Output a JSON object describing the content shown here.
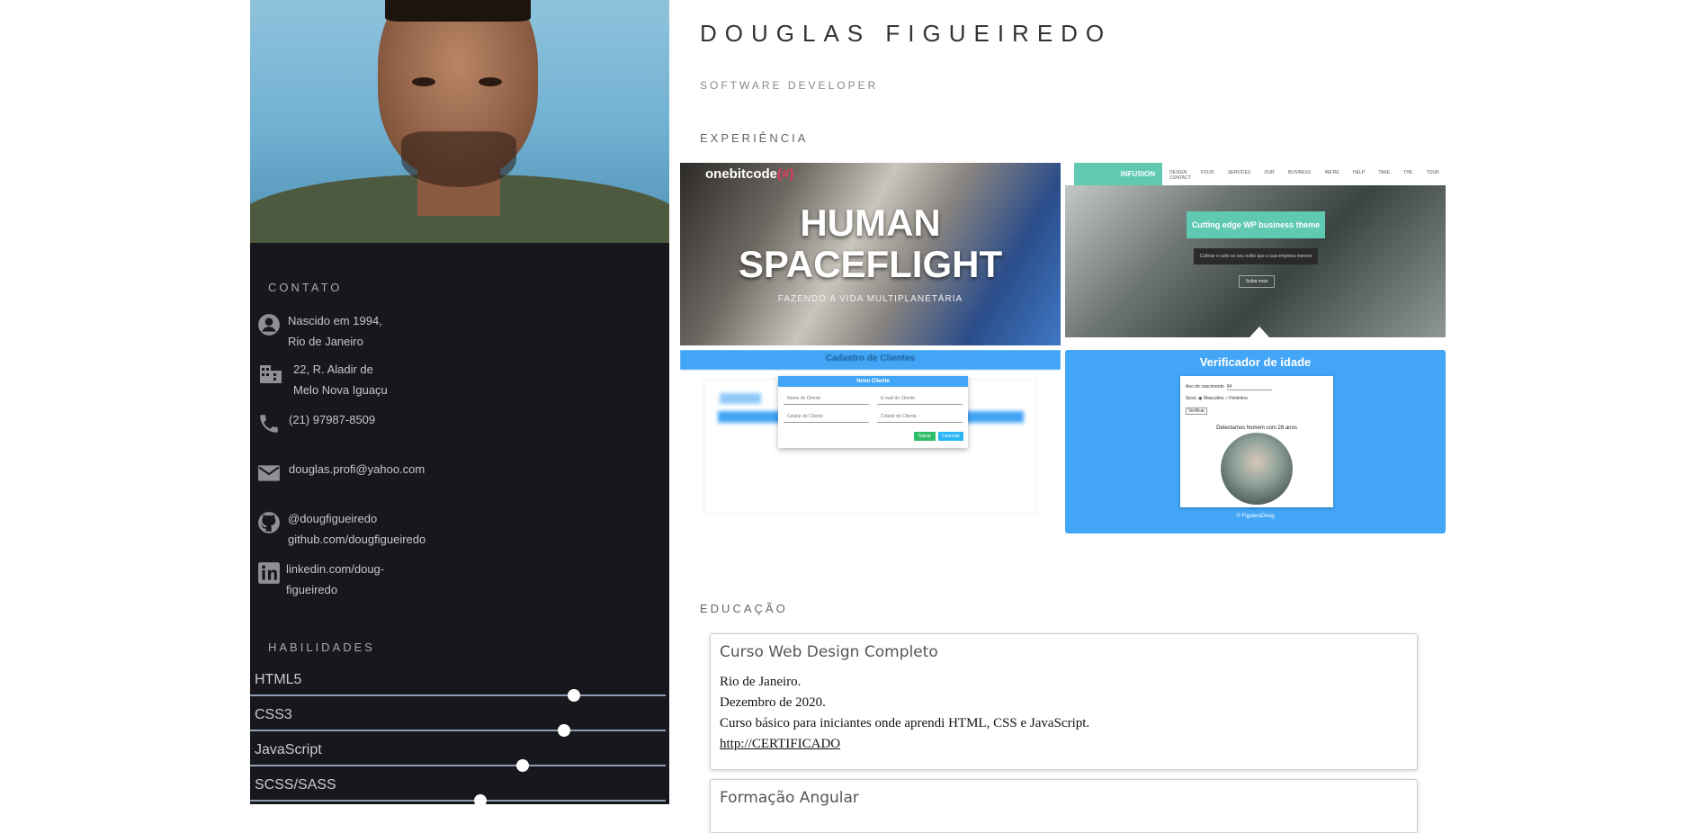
{
  "profile": {
    "name": "DOUGLAS FIGUEIREDO",
    "role": "SOFTWARE DEVELOPER"
  },
  "sidebar": {
    "contact_title": "CONTATO",
    "contacts": [
      {
        "icon": "person-icon",
        "line1": "Nascido em 1994,",
        "line2": "Rio de Janeiro"
      },
      {
        "icon": "building-icon",
        "line1": "22, R. Aladir de",
        "line2": "Melo Nova Iguaçu"
      },
      {
        "icon": "phone-icon",
        "line1": "(21) 97987-8509",
        "line2": ""
      },
      {
        "icon": "email-icon",
        "line1": "douglas.profi@yahoo.com",
        "line2": ""
      },
      {
        "icon": "github-icon",
        "line1": "@dougfigueiredo",
        "line2": "github.com/dougfigueiredo"
      },
      {
        "icon": "linkedin-icon",
        "line1": "linkedin.com/doug-",
        "line2": "figueiredo"
      }
    ],
    "skills_title": "HABILIDADES",
    "skills": [
      {
        "label": "HTML5",
        "level": 0.78
      },
      {
        "label": "CSS3",
        "level": 0.755
      },
      {
        "label": "JavaScript",
        "level": 0.655
      },
      {
        "label": "SCSS/SASS",
        "level": 0.555
      }
    ]
  },
  "main": {
    "experience_title": "EXPERIÊNCIA",
    "projects": {
      "p1": {
        "brand": "onebitcode",
        "brand_mark": "(#)",
        "line1": "HUMAN",
        "line2": "SPACEFLIGHT",
        "sub": "FAZENDO A VIDA MULTIPLANETÁRIA"
      },
      "p2": {
        "logo": "INFUSION",
        "menu": "DESIGN FOLIO SERVICES OUR BUSINESS WE'RE HELP TAKE THE TOUR CONTACT",
        "cta": "Cutting edge WP business theme",
        "tagline": "Cultivar o culto ao seu estilo que a sua empresa merece",
        "button": "Saiba mais"
      },
      "p3": {
        "header": "Cadastro de Clientes",
        "modal_title": "Novo Cliente",
        "f1": "Nome do Cliente",
        "f2": "E-mail do Cliente",
        "f3": "Celular do Cliente",
        "f4": "Cidade do Cliente",
        "ok": "Salvar",
        "cancel": "Cancelar"
      },
      "p4": {
        "title": "Verificador de idade",
        "field": "Ano de nascimento",
        "field_value": "94",
        "sex": "Sexo:",
        "male": "Masculino",
        "female": "Feminino",
        "verify": "Verificar",
        "result": "Detectamos homem com 28 anos",
        "footer": "© FiguieraDoug"
      }
    },
    "education_title": "EDUCAÇÃO",
    "education": [
      {
        "title": "Curso Web Design Completo",
        "city": "Rio de Janeiro.",
        "date": "Dezembro de 2020.",
        "desc": "Curso básico para iniciantes onde aprendi HTML, CSS e JavaScript.",
        "link": "http://CERTIFICADO"
      },
      {
        "title": "Formação Angular"
      }
    ]
  }
}
